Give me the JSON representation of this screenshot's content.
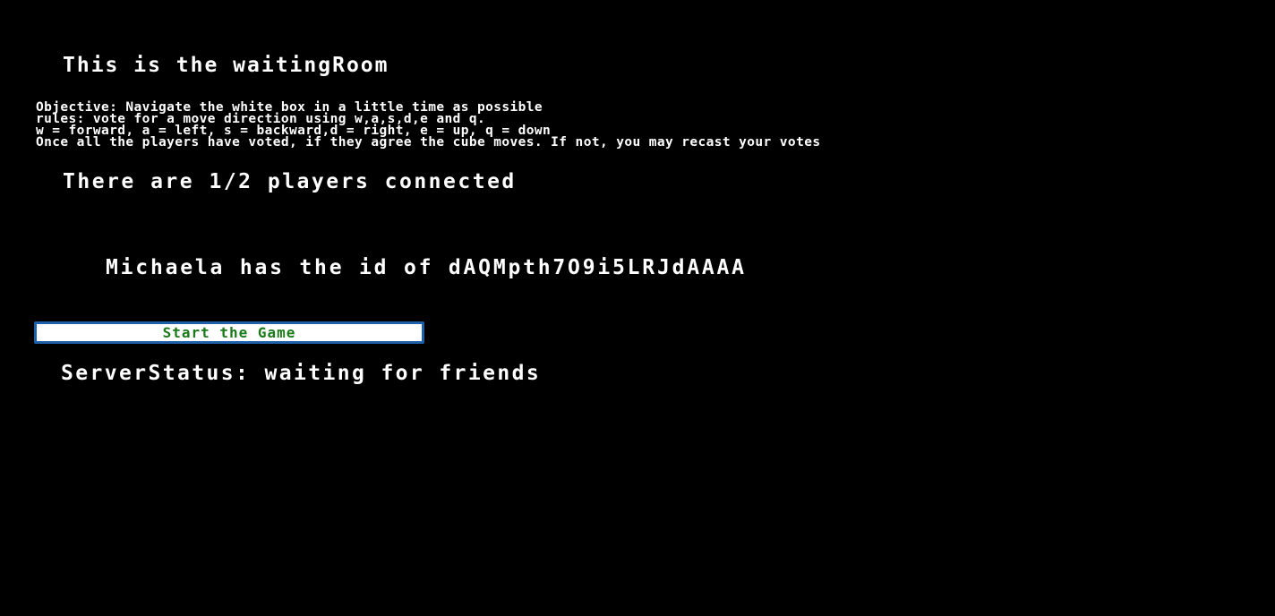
{
  "heading": "This is the waitingRoom",
  "rules": {
    "objective": "Objective: Navigate the white box in a little time as possible",
    "rules_line": "rules: vote for a move direction using w,a,s,d,e and q.",
    "keys_line": "w = forward, a = left, s = backward,d = right, e = up, q = down",
    "voting_line": "Once all the players have voted, if they agree the cube moves. If not, you may recast your votes"
  },
  "players_connected": "There are 1/2 players connected",
  "player_list": [
    {
      "text": "Michaela has the id of dAQMpth7O9i5LRJdAAAA"
    }
  ],
  "start_button": {
    "label": "Start the Game"
  },
  "server_status": "ServerStatus: waiting for friends",
  "colors": {
    "background": "#000000",
    "text": "#ffffff",
    "button_text": "#1a7a1a",
    "button_border": "#1f5fa8"
  }
}
